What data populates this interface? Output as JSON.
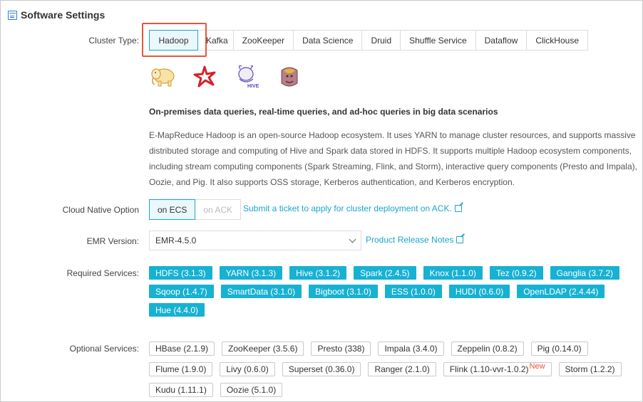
{
  "section": {
    "title": "Software Settings",
    "icon": "settings-panel-icon"
  },
  "cluster_type": {
    "label": "Cluster Type:",
    "tabs": [
      "Hadoop",
      "Kafka",
      "ZooKeeper",
      "Data Science",
      "Druid",
      "Shuffle Service",
      "Dataflow",
      "ClickHouse"
    ],
    "selected": "Hadoop"
  },
  "logos": [
    "hadoop-elephant-logo",
    "spark-star-logo",
    "hive-bee-logo",
    "presto-logo"
  ],
  "headline": "On-premises data queries, real-time queries, and ad-hoc queries in big data scenarios",
  "description": "E-MapReduce Hadoop is an open-source Hadoop ecosystem. It uses YARN to manage cluster resources, and supports massive distributed storage and computing of Hive and Spark data stored in HDFS. It supports multiple Hadoop ecosystem components, including stream computing components (Spark Streaming, Flink, and Storm), interactive query components (Presto and Impala), Oozie, and Pig. It also supports OSS storage, Kerberos authentication, and Kerberos encryption.",
  "cloud_native": {
    "label": "Cloud Native Option",
    "options": [
      "on ECS",
      "on ACK"
    ],
    "selected": "on ECS",
    "link": "Submit a ticket to apply for cluster deployment on ACK."
  },
  "emr_version": {
    "label": "EMR Version:",
    "value": "EMR-4.5.0",
    "link": "Product Release Notes"
  },
  "required_services": {
    "label": "Required Services:",
    "items": [
      "HDFS (3.1.3)",
      "YARN (3.1.3)",
      "Hive (3.1.2)",
      "Spark (2.4.5)",
      "Knox (1.1.0)",
      "Tez (0.9.2)",
      "Ganglia (3.7.2)",
      "Sqoop (1.4.7)",
      "SmartData (3.1.0)",
      "Bigboot (3.1.0)",
      "ESS (1.0.0)",
      "HUDI (0.6.0)",
      "OpenLDAP (2.4.44)",
      "Hue (4.4.0)"
    ]
  },
  "optional_services": {
    "label": "Optional Services:",
    "items": [
      "HBase (2.1.9)",
      "ZooKeeper (3.5.6)",
      "Presto (338)",
      "Impala (3.4.0)",
      "Zeppelin (0.8.2)",
      "Pig (0.14.0)",
      "Flume (1.9.0)",
      "Livy (0.6.0)",
      "Superset (0.36.0)",
      "Ranger (2.1.0)",
      "Flink (1.10-vvr-1.0.2)",
      "Storm (1.2.2)",
      "Kudu (1.11.1)",
      "Oozie (5.1.0)"
    ],
    "new_badge_item": "Flink (1.10-vvr-1.0.2)",
    "new_badge": "New"
  },
  "colors": {
    "accent": "#17b1d2",
    "highlight": "#e8563a"
  }
}
